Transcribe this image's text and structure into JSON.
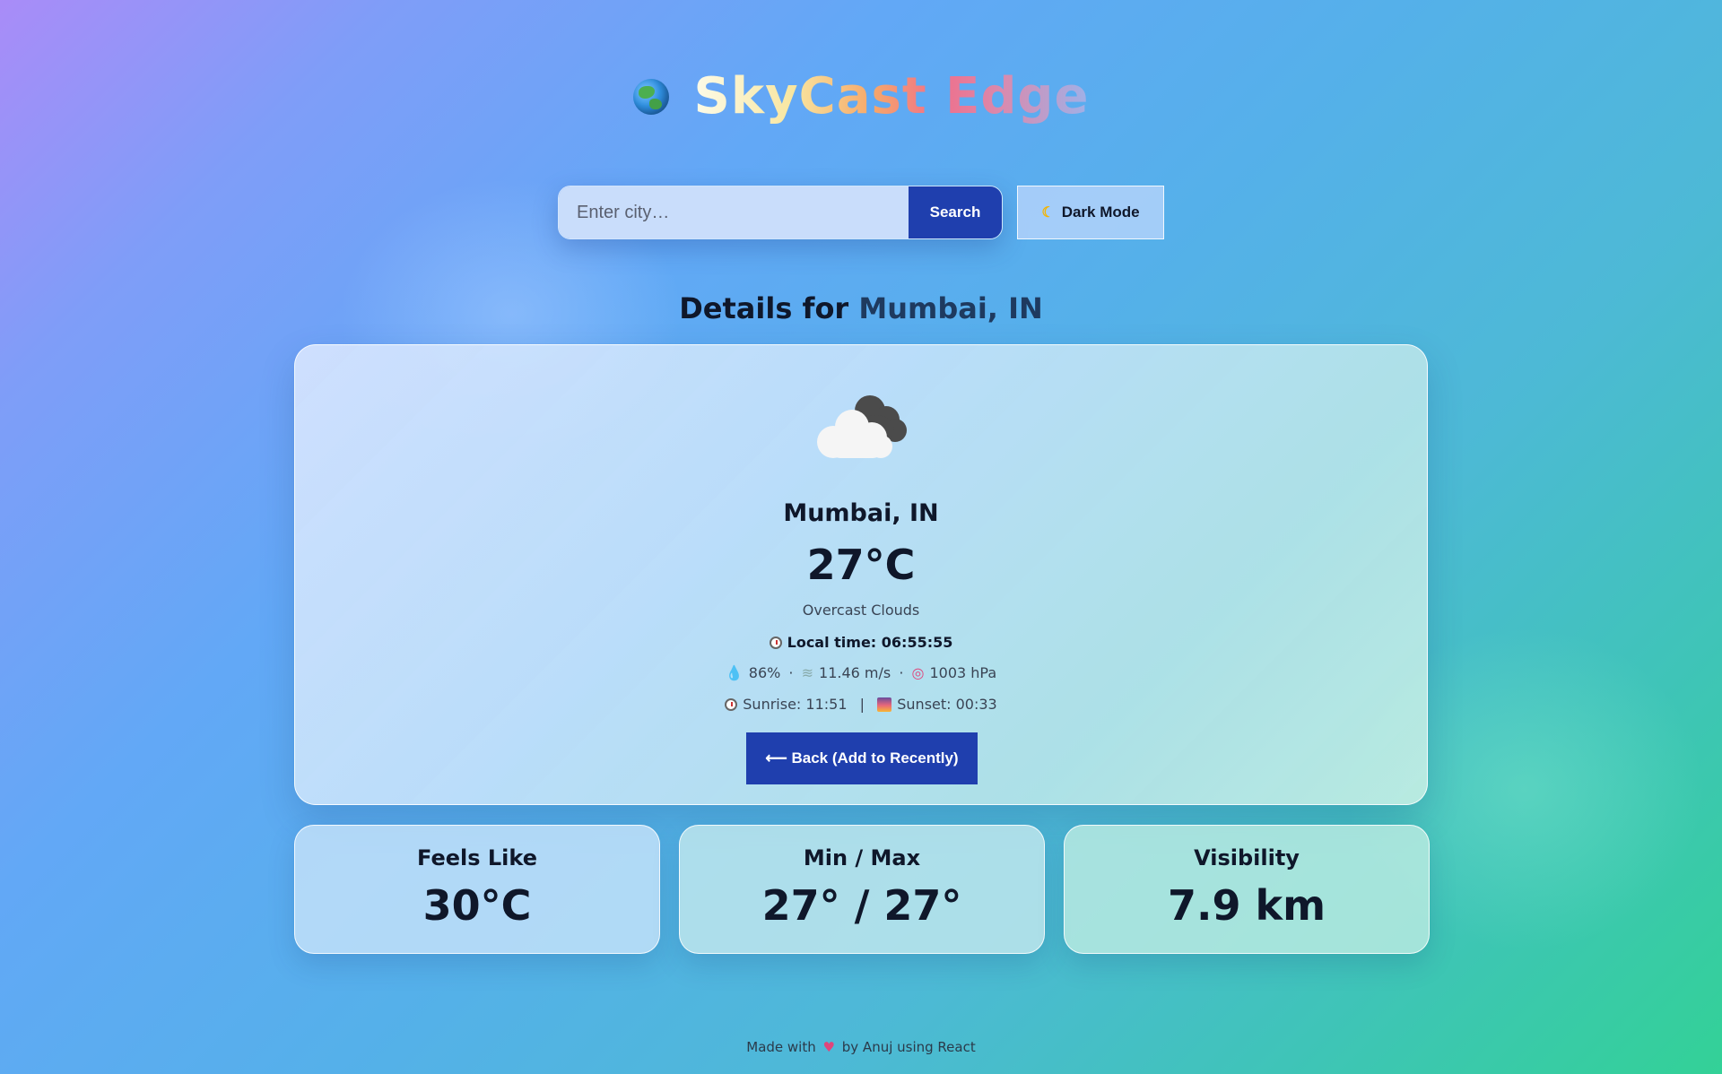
{
  "app": {
    "title": "SkyCast Edge",
    "globe_icon": "globe-icon"
  },
  "search": {
    "placeholder": "Enter city…",
    "value": "",
    "button_label": "Search"
  },
  "theme_toggle": {
    "icon": "moon-icon",
    "label": "Dark Mode"
  },
  "details": {
    "prefix": "Details for",
    "city": "Mumbai, IN"
  },
  "weather": {
    "icon": "cloud-icon",
    "city": "Mumbai, IN",
    "temperature": "27°C",
    "description": "Overcast Clouds",
    "local_time": "Local time: 06:55:55",
    "humidity": "86%",
    "wind": "11.46 m/s",
    "pressure": "1003 hPa",
    "sunrise": "Sunrise: 11:51",
    "sunset": "Sunset: 00:33",
    "back_button": "⟵ Back (Add to Recently)"
  },
  "stats": [
    {
      "label": "Feels Like",
      "value": "30°C"
    },
    {
      "label": "Min / Max",
      "value": "27° / 27°"
    },
    {
      "label": "Visibility",
      "value": "7.9 km"
    }
  ],
  "footer": {
    "prefix": "Made with",
    "suffix": "by Anuj using React"
  },
  "colors": {
    "primary_button": "#1f3fae",
    "text_dark": "#0f172a"
  }
}
